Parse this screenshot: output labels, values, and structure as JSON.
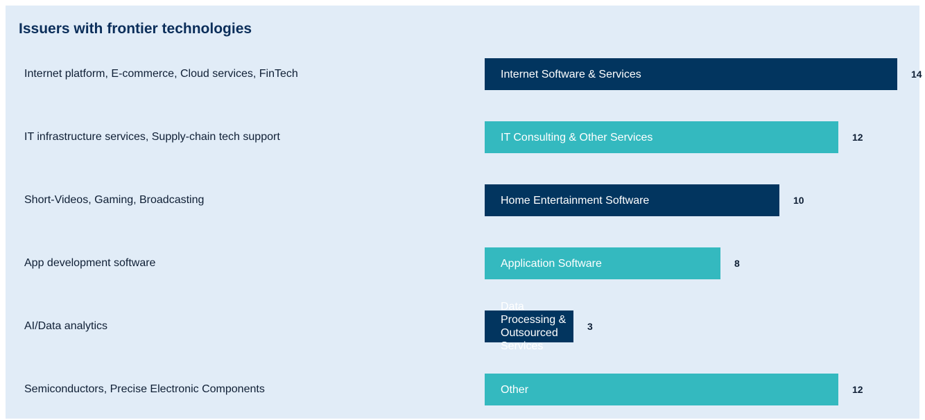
{
  "chart_data": {
    "type": "bar",
    "orientation": "horizontal",
    "title": "Issuers with frontier technologies",
    "categories": [
      "Internet platform, E-commerce, Cloud services, FinTech",
      "IT infrastructure services, Supply-chain tech support",
      "Short-Videos, Gaming, Broadcasting",
      "App development software",
      "AI/Data analytics",
      "Semiconductors, Precise Electronic Components"
    ],
    "bar_labels": [
      "Internet Software & Services",
      "IT Consulting & Other Services",
      "Home Entertainment Software",
      "Application Software",
      "Data Processing & Outsourced Services",
      "Other"
    ],
    "values": [
      14,
      12,
      10,
      8,
      3,
      12
    ],
    "bar_colors": [
      "#02355f",
      "#34b9bf",
      "#02355f",
      "#34b9bf",
      "#02355f",
      "#34b9bf"
    ],
    "xlim": [
      0,
      14
    ],
    "xlabel": "",
    "ylabel": "",
    "grid": false,
    "legend": "none"
  },
  "colors": {
    "background": "#e1ecf7",
    "title": "#0b2e5a",
    "navy": "#02355f",
    "teal": "#34b9bf",
    "text": "#0f1f35"
  }
}
